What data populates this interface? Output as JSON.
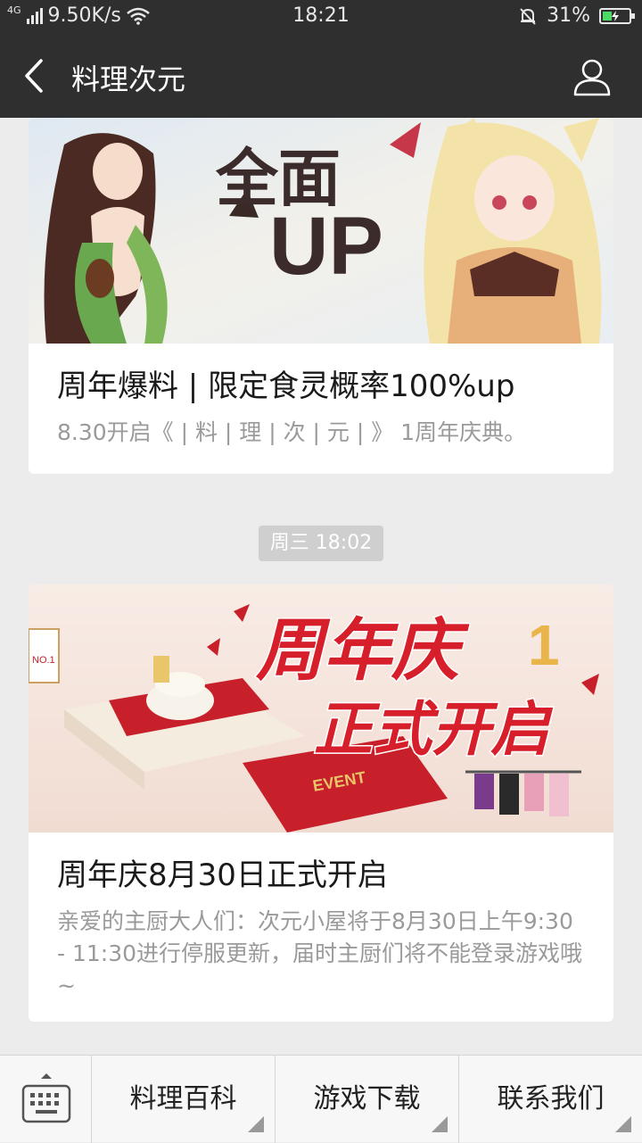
{
  "status": {
    "network": "4G",
    "speed": "9.50K/s",
    "time": "18:21",
    "battery": "31%"
  },
  "header": {
    "title": "料理次元"
  },
  "articles": [
    {
      "banner_text_1": "全面",
      "banner_text_2": "UP",
      "title": "周年爆料 | 限定食灵概率100%up",
      "desc": "8.30开启《 | 料 | 理 | 次 | 元 | 》 1周年庆典。"
    },
    {
      "banner_text_1": "周年庆",
      "banner_text_2": "正式开启",
      "banner_badge": "1",
      "sign_text": "NO.1",
      "banner_event": "EVENT",
      "title": "周年庆8月30日正式开启",
      "desc": "亲爱的主厨大人们：次元小屋将于8月30日上午9:30 - 11:30进行停服更新，届时主厨们将不能登录游戏哦~"
    }
  ],
  "timestamp": "周三 18:02",
  "menu": {
    "items": [
      "料理百科",
      "游戏下载",
      "联系我们"
    ]
  },
  "colors": {
    "header_bg": "#2f2f2f",
    "page_bg": "#ececec",
    "battery": "#4cd964"
  }
}
